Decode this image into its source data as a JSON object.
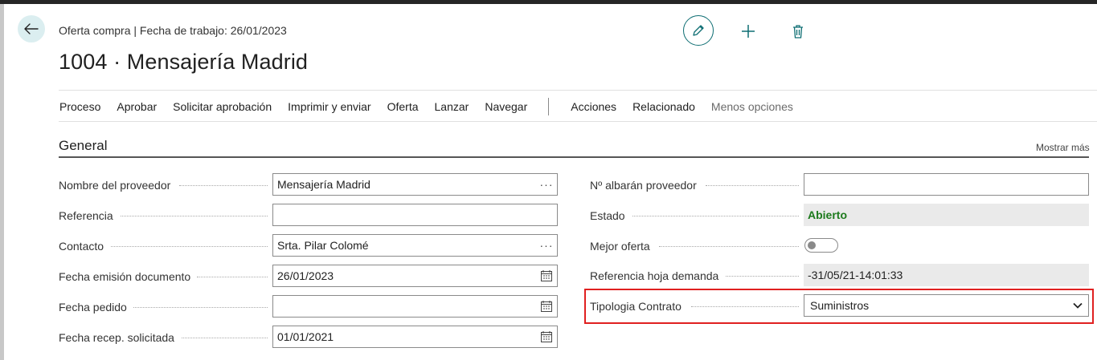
{
  "header": {
    "context": "Oferta compra | Fecha de trabajo: 26/01/2023",
    "title": "1004 · Mensajería Madrid"
  },
  "icons": {
    "back": "arrow-left-icon",
    "edit": "pencil-icon",
    "new": "plus-icon",
    "delete": "trash-icon"
  },
  "actions": {
    "primary": [
      "Proceso",
      "Aprobar",
      "Solicitar aprobación",
      "Imprimir y enviar",
      "Oferta",
      "Lanzar",
      "Navegar"
    ],
    "secondary": [
      "Acciones",
      "Relacionado",
      "Menos opciones"
    ]
  },
  "general": {
    "title": "General",
    "show_more": "Mostrar más",
    "left": [
      {
        "label": "Nombre del proveedor",
        "value": "Mensajería Madrid",
        "control": "lookup"
      },
      {
        "label": "Referencia",
        "value": "",
        "control": "text"
      },
      {
        "label": "Contacto",
        "value": "Srta. Pilar Colomé",
        "control": "lookup"
      },
      {
        "label": "Fecha emisión documento",
        "value": "26/01/2023",
        "control": "date"
      },
      {
        "label": "Fecha pedido",
        "value": "",
        "control": "date"
      },
      {
        "label": "Fecha recep. solicitada",
        "value": "01/01/2021",
        "control": "date"
      }
    ],
    "right": [
      {
        "label": "Nº albarán proveedor",
        "value": "",
        "control": "text"
      },
      {
        "label": "Estado",
        "value": "Abierto",
        "control": "readonly"
      },
      {
        "label": "Mejor oferta",
        "value": "off",
        "control": "toggle"
      },
      {
        "label": "Referencia hoja demanda",
        "value": "-31/05/21-14:01:33",
        "control": "readonly"
      },
      {
        "label": "Tipologia Contrato",
        "value": "Suministros",
        "control": "select"
      }
    ]
  },
  "colors": {
    "accent": "#0e6e73",
    "status_green": "#1c7a1c",
    "highlight": "#e02020"
  }
}
